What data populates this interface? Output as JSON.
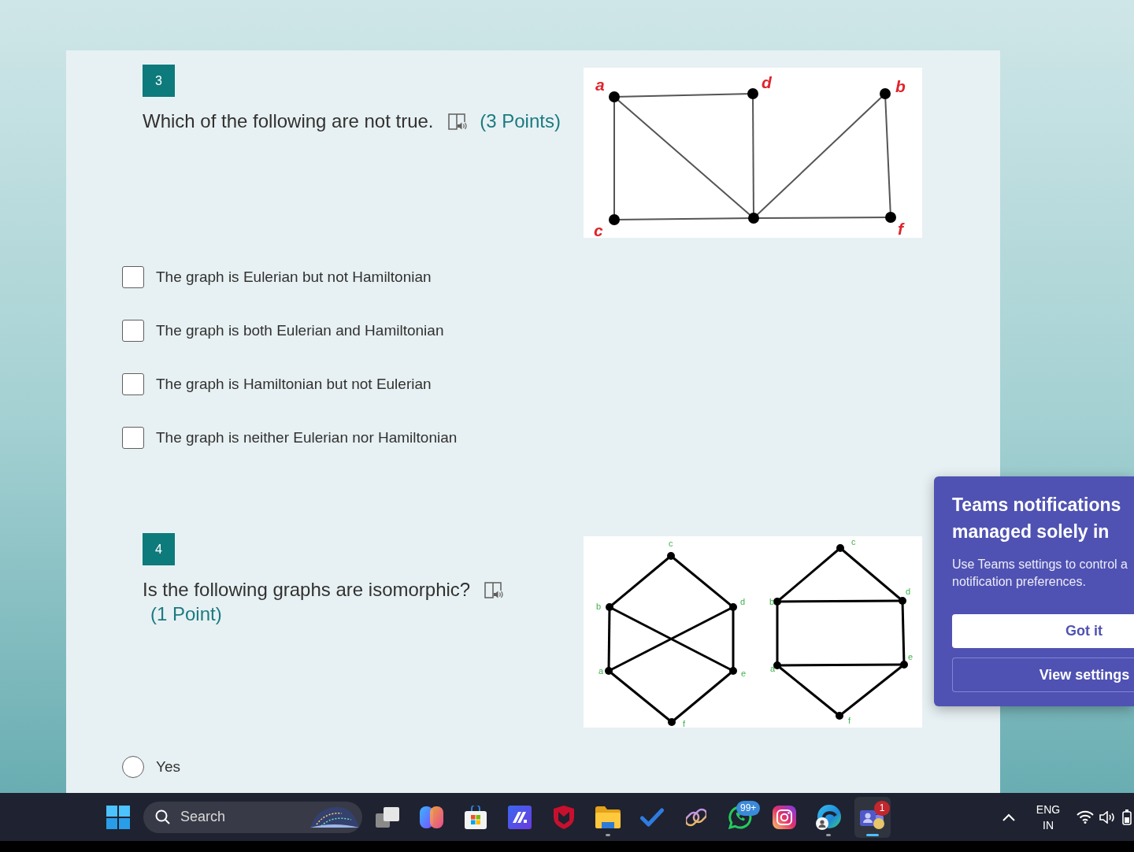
{
  "form": {
    "questions": [
      {
        "kind": "checkbox",
        "number": "3",
        "text": "Which of the following are not true.",
        "points": "(3 Points)",
        "figure": {
          "kind": "rectangle-graph",
          "graphs": [
            {
              "labels": [
                "a",
                "d",
                "b",
                "c",
                "f"
              ]
            }
          ]
        },
        "options": [
          {
            "label": "The graph is Eulerian but not Hamiltonian",
            "checked": false
          },
          {
            "label": "The graph is both Eulerian and Hamiltonian",
            "checked": false
          },
          {
            "label": "The graph is Hamiltonian but not Eulerian",
            "checked": false
          },
          {
            "label": "The graph is neither Eulerian nor Hamiltonian",
            "checked": false
          }
        ]
      },
      {
        "kind": "radio",
        "number": "4",
        "text": "Is the following graphs are isomorphic?",
        "points": "(1 Point)",
        "figure": {
          "kind": "hexagon-pair",
          "graphs": [
            {
              "labels": [
                "c",
                "b",
                "d",
                "a",
                "e",
                "f"
              ]
            },
            {
              "labels": [
                "c",
                "b",
                "d",
                "a",
                "e",
                "f"
              ]
            }
          ]
        },
        "options": [
          {
            "label": "Yes",
            "selected": false
          }
        ]
      }
    ]
  },
  "notification": {
    "title": "Teams notifications managed solely in",
    "message": "Use Teams settings to control a notification preferences.",
    "buttons": [
      {
        "label": "Got it",
        "kind": "primary"
      },
      {
        "label": "View settings",
        "kind": "secondary"
      }
    ]
  },
  "taskbar": {
    "search": {
      "placeholder": "Search"
    },
    "apps": [
      {
        "running": false,
        "selected": false
      },
      {
        "running": false,
        "selected": false
      },
      {
        "running": false,
        "selected": false
      },
      {
        "running": false,
        "selected": false
      },
      {
        "running": false,
        "selected": false
      },
      {
        "running": true,
        "selected": false
      },
      {
        "running": false,
        "selected": false
      },
      {
        "running": false,
        "selected": false
      },
      {
        "running": false,
        "selected": false,
        "badge": "99+"
      },
      {
        "running": false,
        "selected": false
      },
      {
        "running": true,
        "selected": false
      },
      {
        "running": true,
        "selected": true,
        "badge": "1"
      }
    ],
    "tray": {
      "language": "ENG",
      "region": "IN"
    }
  }
}
